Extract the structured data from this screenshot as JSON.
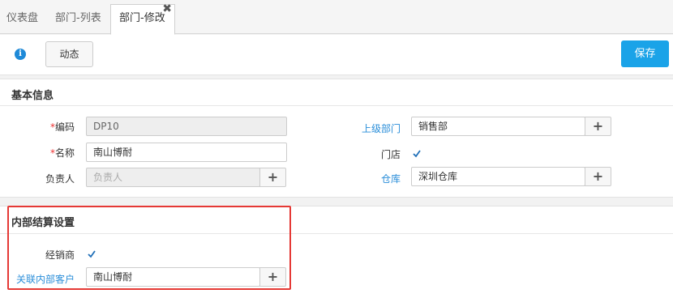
{
  "tabs": [
    {
      "label": "仪表盘"
    },
    {
      "label": "部门-列表"
    },
    {
      "label": "部门-修改"
    }
  ],
  "toolbar": {
    "info_icon": "info-icon",
    "dynamic_label": "动态",
    "save_label": "保存"
  },
  "basic": {
    "title": "基本信息",
    "code_label": "编码",
    "code_value": "DP10",
    "name_label": "名称",
    "name_value": "南山博耐",
    "owner_label": "负责人",
    "owner_placeholder": "负责人",
    "parent_label": "上级部门",
    "parent_value": "销售部",
    "store_label": "门店",
    "warehouse_label": "仓库",
    "warehouse_value": "深圳仓库"
  },
  "settlement": {
    "title": "内部结算设置",
    "dealer_label": "经销商",
    "customer_label": "关联内部客户",
    "customer_value": "南山博耐"
  },
  "colors": {
    "accent": "#1aa3e8",
    "link": "#2a8ed9",
    "highlight": "#e53935"
  }
}
